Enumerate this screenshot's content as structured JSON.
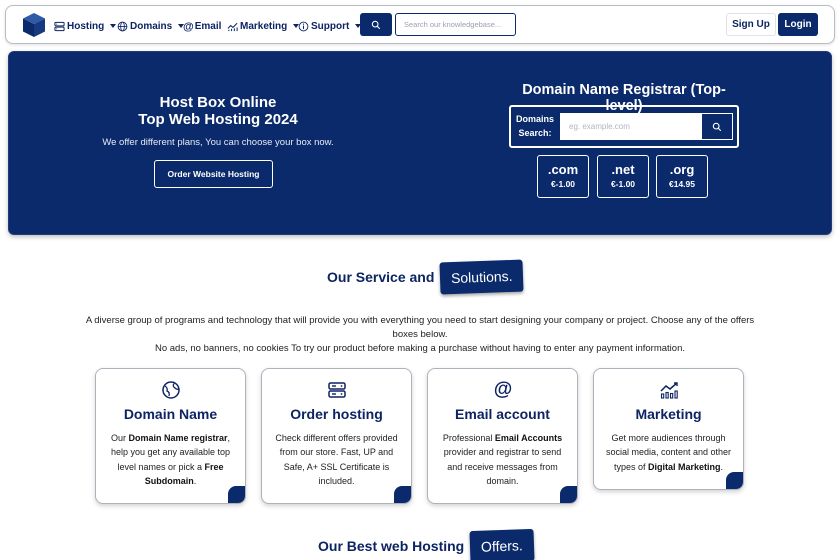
{
  "nav": {
    "items": [
      {
        "label": "Hosting",
        "icon": "server-icon",
        "dropdown": true
      },
      {
        "label": "Domains",
        "icon": "globe-icon",
        "dropdown": true
      },
      {
        "label": "Email",
        "icon": "at-icon",
        "dropdown": false
      },
      {
        "label": "Marketing",
        "icon": "chart-icon",
        "dropdown": true
      },
      {
        "label": "Support",
        "icon": "info-icon",
        "dropdown": true
      }
    ],
    "search_placeholder": "Search our knowledgebase...",
    "signup_label": "Sign Up",
    "login_label": "Login"
  },
  "hero": {
    "title_line1": "Host Box Online",
    "title_line2": "Top Web Hosting 2024",
    "subtitle": "We offer different plans, You can choose your box now.",
    "order_button": "Order Website Hosting",
    "registrar_title": "Domain Name Registrar (Top-level)",
    "domains_label_line1": "Domains",
    "domains_label_line2": "Search:",
    "domain_placeholder": "eg. example.com",
    "tlds": [
      {
        "name": ".com",
        "price": "€-1.00"
      },
      {
        "name": ".net",
        "price": "€-1.00"
      },
      {
        "name": ".org",
        "price": "€14.95"
      }
    ]
  },
  "services": {
    "title": "Our Service and",
    "title_highlight": "Solutions.",
    "desc_line1": "A diverse group of programs and technology that will provide you with everything you need to start designing your company or project. Choose any of the offers boxes below.",
    "desc_line2": "No ads, no banners, no cookies To try our product before making a purchase without having to enter any payment information.",
    "cards": [
      {
        "title": "Domain Name",
        "icon": "globe-icon",
        "t1": "Our ",
        "b1": "Domain Name registrar",
        "t2": ", help you get any available top level names or pick a ",
        "b2": "Free Subdomain",
        "t3": "."
      },
      {
        "title": "Order hosting",
        "icon": "server-icon",
        "t1": "Check different offers provided from our store. Fast, UP and Safe, A+ SSL Certificate is included.",
        "b1": "",
        "t2": "",
        "b2": "",
        "t3": ""
      },
      {
        "title": "Email account",
        "icon": "at-icon",
        "t1": "Professional ",
        "b1": "Email Accounts",
        "t2": " provider and registrar to send and receive messages from domain.",
        "b2": "",
        "t3": ""
      },
      {
        "title": "Marketing",
        "icon": "chart-icon",
        "t1": "Get more audiences through social media, content and other types of ",
        "b1": "Digital Marketing",
        "t2": ".",
        "b2": "",
        "t3": ""
      }
    ]
  },
  "offers": {
    "title": "Our Best web Hosting",
    "title_highlight": "Offers."
  },
  "colors": {
    "primary": "#0a2a6b",
    "text_dark": "#0d2463",
    "white": "#ffffff"
  }
}
